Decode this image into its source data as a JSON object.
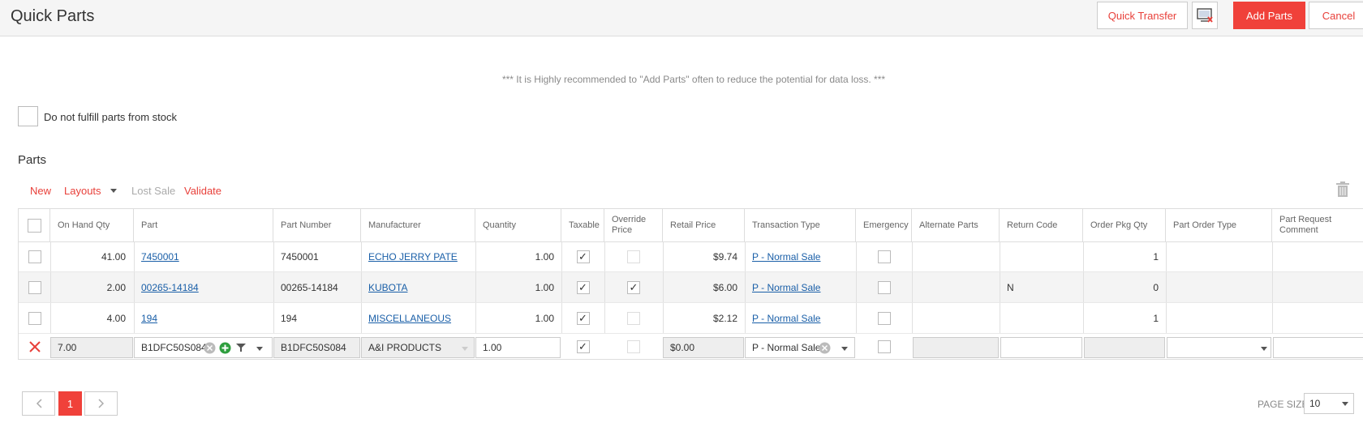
{
  "header": {
    "title": "Quick Parts",
    "quick_transfer": "Quick Transfer",
    "add_parts": "Add Parts",
    "cancel": "Cancel"
  },
  "notice": "*** It is Highly recommended to \"Add Parts\" often to reduce the potential for data loss. ***",
  "fulfill_label": "Do not fulfill parts from stock",
  "section_title": "Parts",
  "toolbar": {
    "new": "New",
    "layouts": "Layouts",
    "lost_sale": "Lost Sale",
    "validate": "Validate"
  },
  "columns": [
    "On Hand Qty",
    "Part",
    "Part Number",
    "Manufacturer",
    "Quantity",
    "Taxable",
    "Override Price",
    "Retail Price",
    "Transaction Type",
    "Emergency",
    "Alternate Parts",
    "Return Code",
    "Order Pkg Qty",
    "Part Order Type",
    "Part Request Comment"
  ],
  "rows": [
    {
      "on_hand": "41.00",
      "part": "7450001",
      "part_number": "7450001",
      "manufacturer": "ECHO JERRY PATE",
      "quantity": "1.00",
      "taxable": true,
      "override": false,
      "retail": "$9.74",
      "transaction": "P - Normal Sale",
      "emergency": false,
      "alternate": "",
      "return_code": "",
      "order_pkg": "1",
      "order_type": "",
      "comment": ""
    },
    {
      "on_hand": "2.00",
      "part": "00265-14184",
      "part_number": "00265-14184",
      "manufacturer": "KUBOTA",
      "quantity": "1.00",
      "taxable": true,
      "override": true,
      "retail": "$6.00",
      "transaction": "P - Normal Sale",
      "emergency": false,
      "alternate": "",
      "return_code": "N",
      "order_pkg": "0",
      "order_type": "",
      "comment": ""
    },
    {
      "on_hand": "4.00",
      "part": "194",
      "part_number": "194",
      "manufacturer": "MISCELLANEOUS",
      "quantity": "1.00",
      "taxable": true,
      "override": false,
      "retail": "$2.12",
      "transaction": "P - Normal Sale",
      "emergency": false,
      "alternate": "",
      "return_code": "",
      "order_pkg": "1",
      "order_type": "",
      "comment": ""
    }
  ],
  "edit_row": {
    "on_hand": "7.00",
    "part": "B1DFC50S084",
    "part_number": "B1DFC50S084",
    "manufacturer": "A&I PRODUCTS",
    "quantity": "1.00",
    "taxable": true,
    "override": false,
    "retail": "$0.00",
    "transaction": "P - Normal Sale",
    "emergency": false
  },
  "pager": {
    "current_page": "1",
    "page_size_label": "PAGE SIZE",
    "page_size": "10"
  },
  "colors": {
    "accent": "#f0413a",
    "link": "#1a5fa8"
  }
}
